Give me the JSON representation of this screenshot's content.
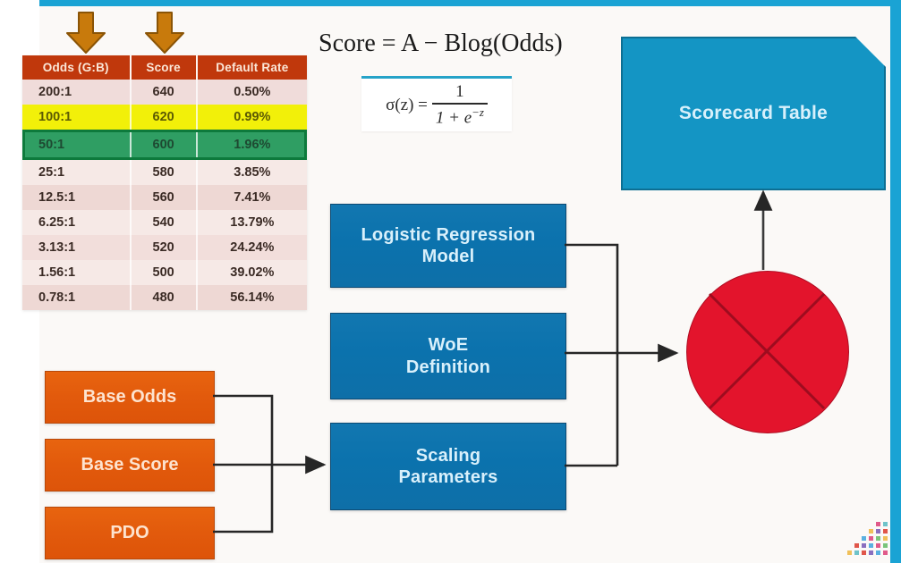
{
  "slide": {
    "title_formula": "Score = A − Blog(Odds)",
    "accent_color": "#1aa3d4",
    "orange_color": "#e2590c",
    "blue_box_color": "#0b72ad",
    "red_color": "#e3142c",
    "green_highlight": "#2f9e63",
    "yellow_highlight": "#f2f009"
  },
  "sigmoid": {
    "lhs": "σ(z) =",
    "numerator": "1",
    "denominator_base": "1 + e",
    "denominator_exp": "−z"
  },
  "odds_table": {
    "columns": [
      "Odds (G:B)",
      "Score",
      "Default Rate"
    ],
    "rows": [
      {
        "odds": "200:1",
        "score": "640",
        "rate": "0.50%",
        "style": "r-plain-a"
      },
      {
        "odds": "100:1",
        "score": "620",
        "rate": "0.99%",
        "style": "r-yellow"
      },
      {
        "odds": "50:1",
        "score": "600",
        "rate": "1.96%",
        "style": "r-green"
      },
      {
        "odds": "25:1",
        "score": "580",
        "rate": "3.85%",
        "style": "r-plain-b"
      },
      {
        "odds": "12.5:1",
        "score": "560",
        "rate": "7.41%",
        "style": "r-plain-c"
      },
      {
        "odds": "6.25:1",
        "score": "540",
        "rate": "13.79%",
        "style": "r-plain-b"
      },
      {
        "odds": "3.13:1",
        "score": "520",
        "rate": "24.24%",
        "style": "r-plain-d"
      },
      {
        "odds": "1.56:1",
        "score": "500",
        "rate": "39.02%",
        "style": "r-plain-b"
      },
      {
        "odds": "0.78:1",
        "score": "480",
        "rate": "56.14%",
        "style": "r-plain-c"
      }
    ]
  },
  "arrows": {
    "down_arrow_1": "down-arrow-icon",
    "down_arrow_2": "down-arrow-icon"
  },
  "process_boxes": [
    {
      "label": "Logistic Regression\nModel",
      "line1": "Logistic Regression",
      "line2": "Model"
    },
    {
      "label": "WoE Definition",
      "line1": "WoE",
      "line2": "Definition"
    },
    {
      "label": "Scaling Parameters",
      "line1": "Scaling",
      "line2": "Parameters"
    }
  ],
  "input_boxes": [
    {
      "label": "Base Odds"
    },
    {
      "label": "Base Score"
    },
    {
      "label": "PDO"
    }
  ],
  "output": {
    "label": "Scorecard Table"
  },
  "combiner": {
    "name": "multiply-node",
    "glyph": "✕"
  }
}
